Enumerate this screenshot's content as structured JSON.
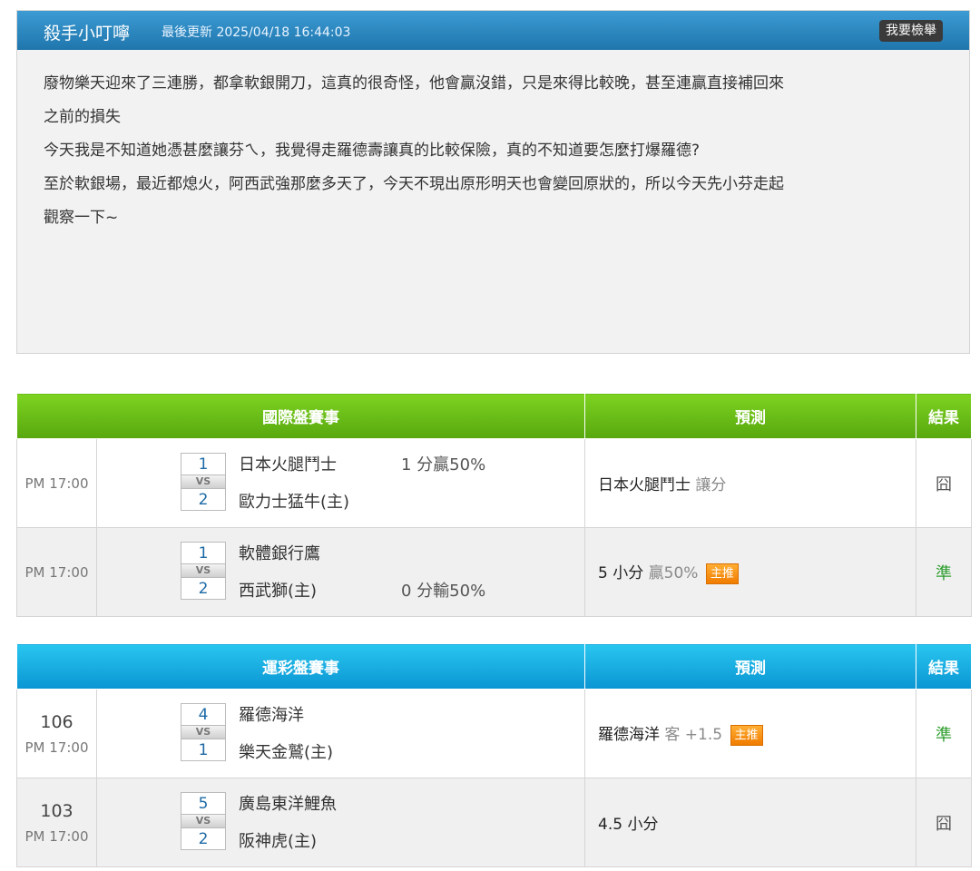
{
  "post": {
    "author": "殺手小叮嚀",
    "updated": "最後更新 2025/04/18 16:44:03",
    "report_label": "我要檢舉",
    "lines": [
      "廢物樂天迎來了三連勝，都拿軟銀開刀，這真的很奇怪，他會贏沒錯，只是來得比較晚，甚至連贏直接補回來",
      "之前的損失",
      "今天我是不知道她憑甚麼讓芬ㄟ，我覺得走羅德壽讓真的比較保險，真的不知道要怎麼打爆羅德?",
      "至於軟銀場，最近都熄火，阿西武強那麼多天了，今天不現出原形明天也會變回原狀的，所以今天先小芬走起",
      "觀察一下~"
    ]
  },
  "intl": {
    "header": {
      "match": "國際盤賽事",
      "pred": "預測",
      "result": "結果"
    },
    "rows": [
      {
        "kickoff": "PM 17:00",
        "score1": "1",
        "vs": "VS",
        "score2": "2",
        "team1": "日本火腿鬥士",
        "team2": "歐力士猛牛(主)",
        "odds1": "1 分贏50%",
        "odds2": "",
        "pred_main": "日本火腿鬥士",
        "pred_dim": " 讓分",
        "badge": "",
        "result": "囧",
        "result_type": "miss"
      },
      {
        "kickoff": "PM 17:00",
        "score1": "1",
        "vs": "VS",
        "score2": "2",
        "team1": "軟體銀行鷹",
        "team2": "西武獅(主)",
        "odds1": "",
        "odds2": "0 分輸50%",
        "pred_main": "5 小分",
        "pred_dim": " 贏50%",
        "badge": "主推",
        "result": "準",
        "result_type": "hit"
      }
    ]
  },
  "sports": {
    "header": {
      "match": "運彩盤賽事",
      "pred": "預測",
      "result": "結果"
    },
    "rows": [
      {
        "game_no": "106",
        "kickoff": "PM 17:00",
        "score1": "4",
        "vs": "VS",
        "score2": "1",
        "team1": "羅德海洋",
        "team2": "樂天金鷲(主)",
        "pred_main": "羅德海洋",
        "pred_dim": " 客 +1.5",
        "badge": "主推",
        "result": "準",
        "result_type": "hit"
      },
      {
        "game_no": "103",
        "kickoff": "PM 17:00",
        "score1": "5",
        "vs": "VS",
        "score2": "2",
        "team1": "廣島東洋鯉魚",
        "team2": "阪神虎(主)",
        "pred_main": "4.5 小分",
        "pred_dim": "",
        "badge": "",
        "result": "囧",
        "result_type": "miss"
      }
    ]
  }
}
